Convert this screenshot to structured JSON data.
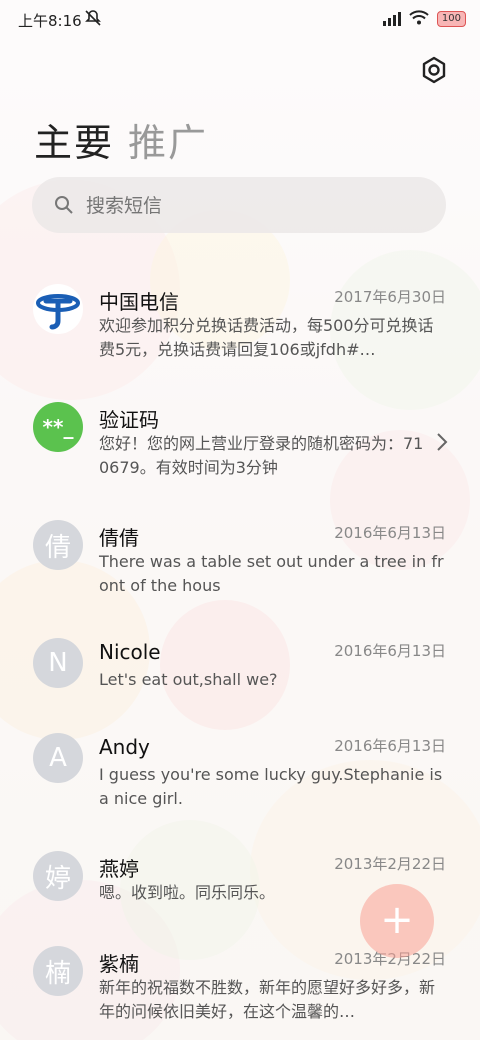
{
  "status_bar": {
    "time": "上午8:16",
    "battery": "100"
  },
  "tabs": {
    "main": "主要",
    "promo": "推广"
  },
  "search": {
    "placeholder": "搜索短信"
  },
  "conversations": [
    {
      "name": "中国电信",
      "date": "2017年6月30日",
      "preview": "欢迎参加积分兑换话费活动，每500分可兑换话费5元，兑换话费请回复106或jfdh#…",
      "avatar": "telecom-logo"
    },
    {
      "name": "验证码",
      "date": "",
      "preview": "您好！您的网上营业厅登录的随机密码为：710679。有效时间为3分钟",
      "avatar": "**_"
    },
    {
      "name": "倩倩",
      "date": "2016年6月13日",
      "preview": "There was a table set out under a tree in front of the hous",
      "avatar": "倩"
    },
    {
      "name": "Nicole",
      "date": "2016年6月13日",
      "preview": "Let's eat out,shall we?",
      "avatar": "N"
    },
    {
      "name": "Andy",
      "date": "2016年6月13日",
      "preview": "I guess you're some lucky guy.Stephanie is a nice girl.",
      "avatar": "A"
    },
    {
      "name": "燕婷",
      "date": "2013年2月22日",
      "preview": "嗯。收到啦。同乐同乐。",
      "avatar": "婷"
    },
    {
      "name": "紫楠",
      "date": "2013年2月22日",
      "preview": "新年的祝福数不胜数，新年的愿望好多好多，新年的问候依旧美好，在这个温馨的…",
      "avatar": "楠"
    }
  ],
  "fab": {
    "label": "+"
  },
  "colors": {
    "accent_green": "#5bc24e",
    "telecom_blue": "#1a5eb5",
    "fab": "#f5a59b"
  }
}
